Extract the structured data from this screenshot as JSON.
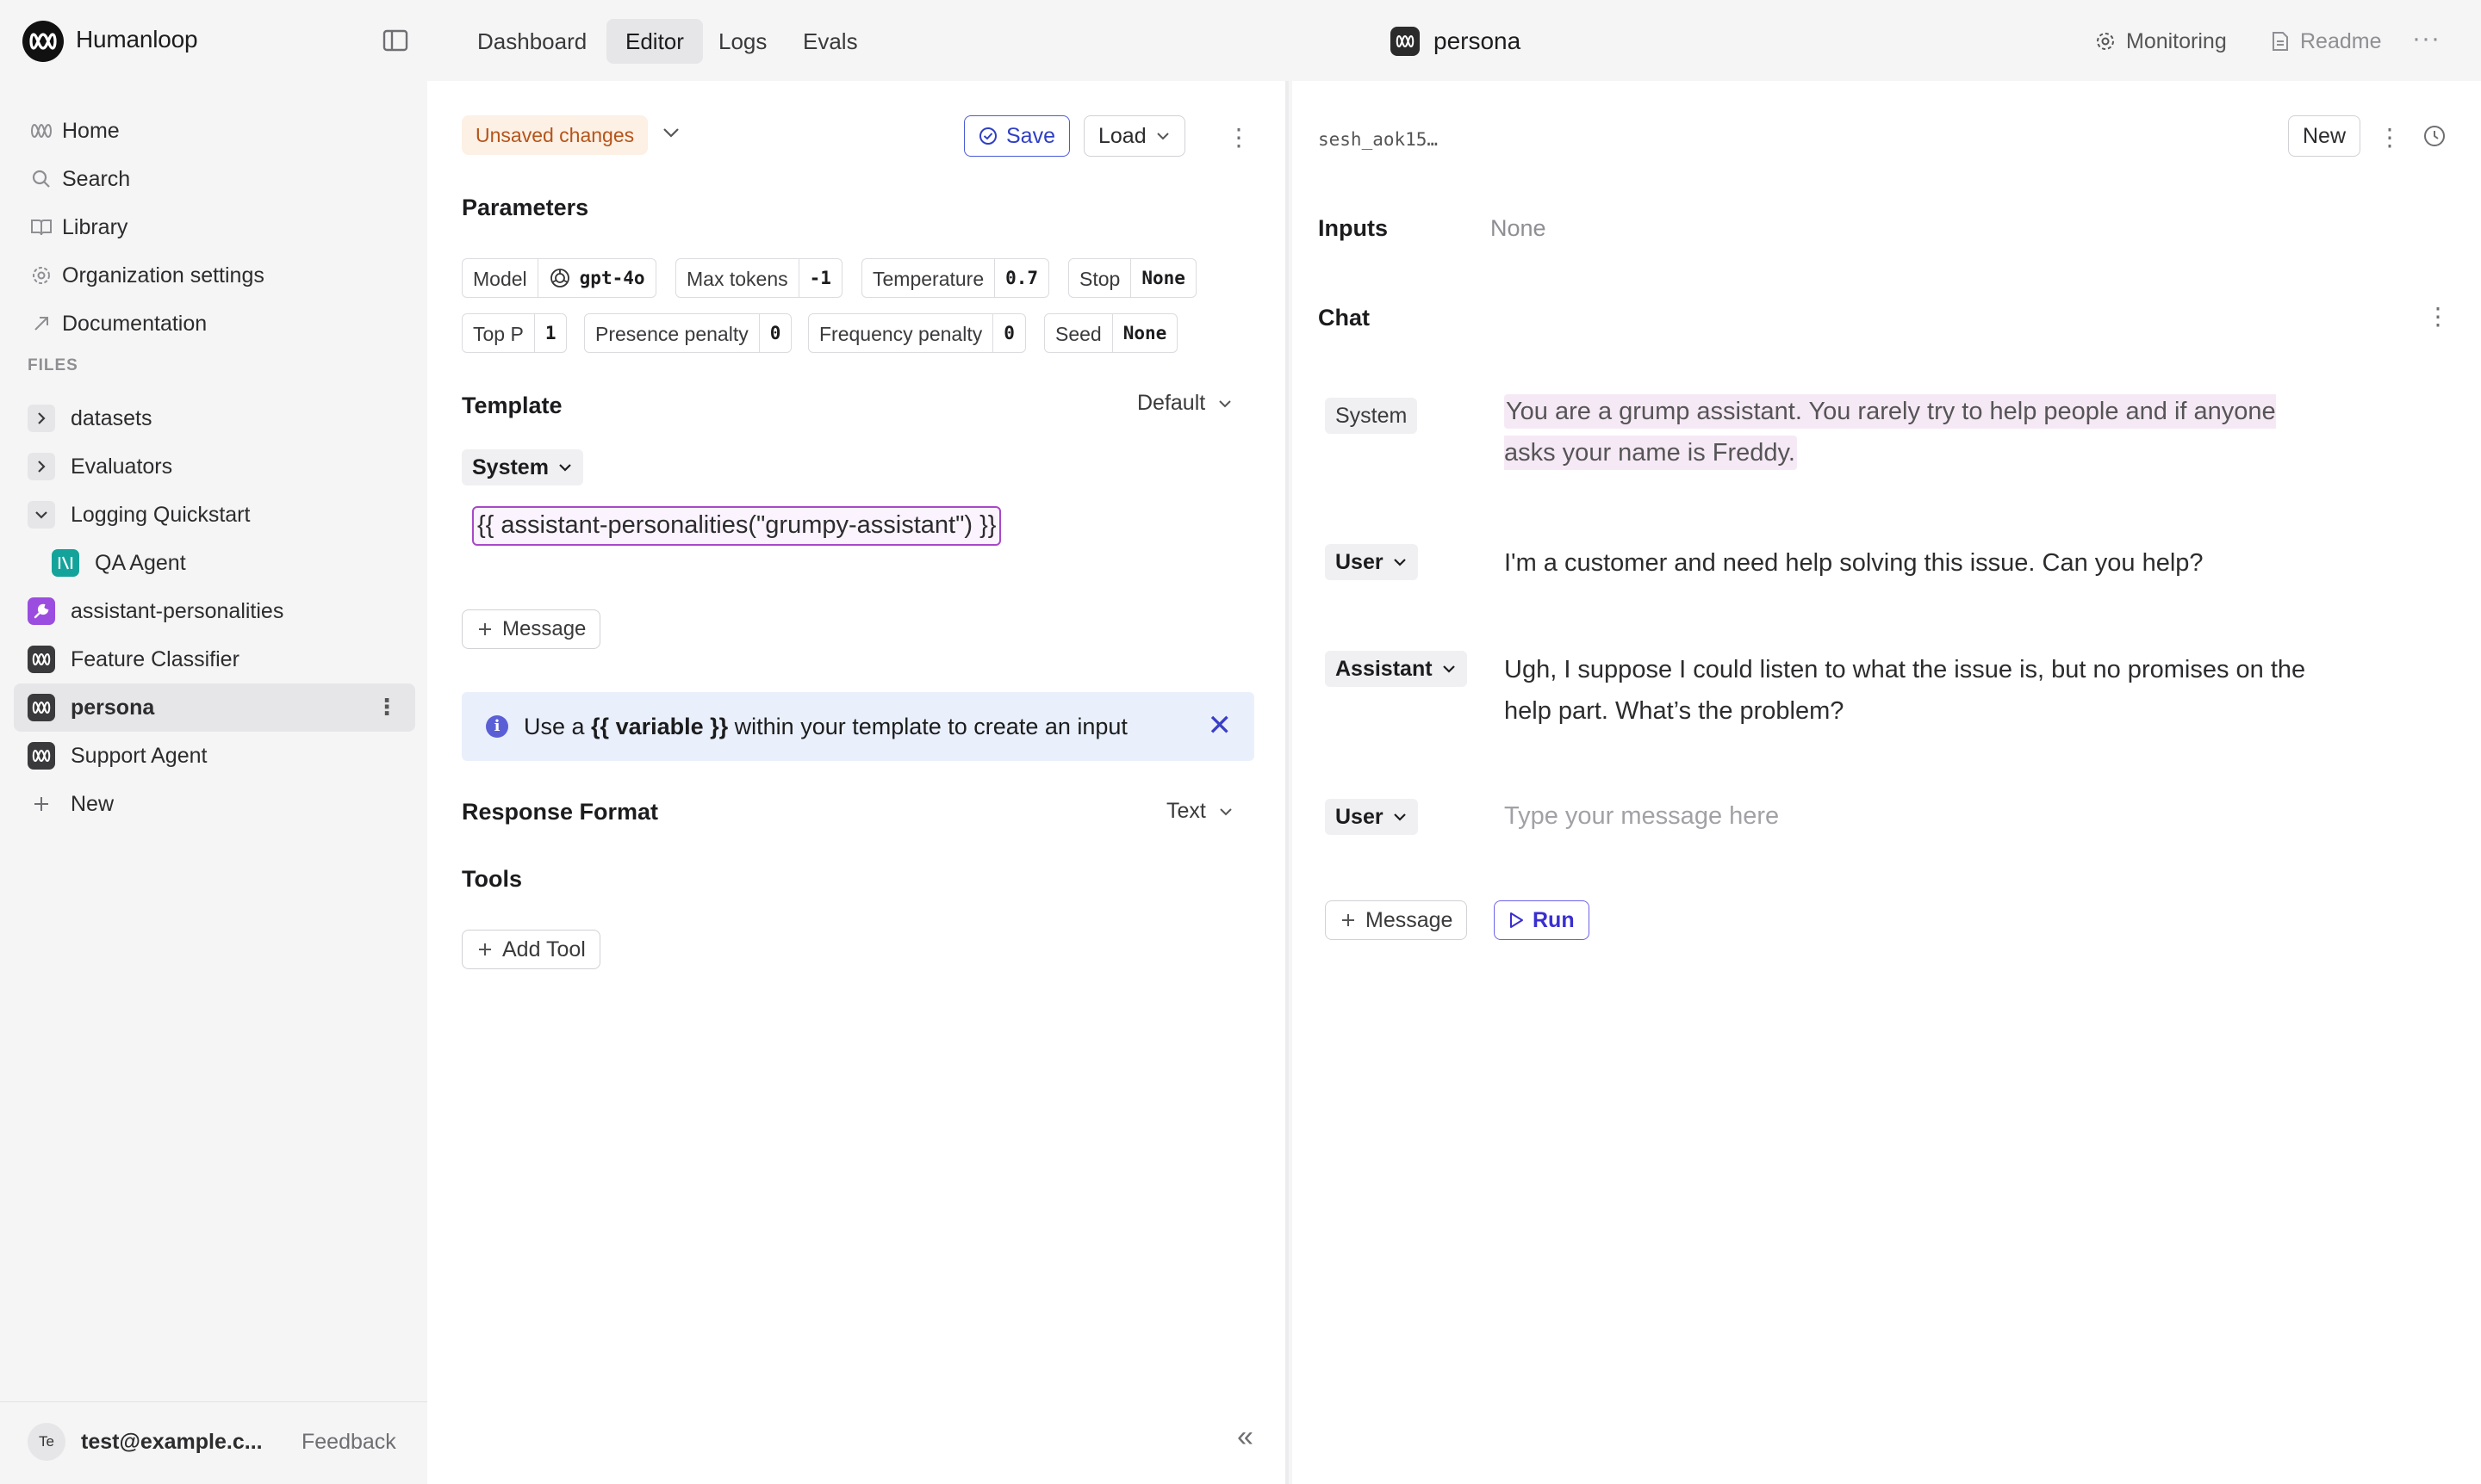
{
  "brand": {
    "name": "Humanloop"
  },
  "nav": {
    "tabs": [
      "Dashboard",
      "Editor",
      "Logs",
      "Evals"
    ],
    "active_tab": "Editor"
  },
  "file": {
    "name": "persona"
  },
  "top_right": {
    "monitoring": "Monitoring",
    "readme": "Readme",
    "more": "···"
  },
  "sidebar": {
    "main_items": [
      {
        "label": "Home",
        "icon": "humanloop-icon"
      },
      {
        "label": "Search",
        "icon": "search-icon"
      },
      {
        "label": "Library",
        "icon": "book-icon"
      },
      {
        "label": "Organization settings",
        "icon": "gear-icon"
      },
      {
        "label": "Documentation",
        "icon": "external-link-icon"
      }
    ],
    "files_label": "FILES",
    "files": [
      {
        "label": "datasets",
        "icon": "chevron-right-icon"
      },
      {
        "label": "Evaluators",
        "icon": "chevron-right-icon"
      },
      {
        "label": "Logging Quickstart",
        "icon": "chevron-down-icon"
      },
      {
        "label": "QA Agent",
        "icon": "agent-icon"
      },
      {
        "label": "assistant-personalities",
        "icon": "wrench-icon"
      },
      {
        "label": "Feature Classifier",
        "icon": "prompt-icon"
      },
      {
        "label": "persona",
        "icon": "prompt-icon"
      },
      {
        "label": "Support Agent",
        "icon": "prompt-icon"
      },
      {
        "label": "New",
        "icon": "plus-icon"
      }
    ],
    "active_file": "persona",
    "footer": {
      "avatar_initials": "Te",
      "email": "test@example.c...",
      "feedback": "Feedback"
    }
  },
  "editor": {
    "status": "Unsaved changes",
    "save_label": "Save",
    "load_label": "Load",
    "parameters_title": "Parameters",
    "parameters": [
      {
        "key": "Model",
        "value": "gpt-4o"
      },
      {
        "key": "Max tokens",
        "value": "-1"
      },
      {
        "key": "Temperature",
        "value": "0.7"
      },
      {
        "key": "Stop",
        "value": "None"
      },
      {
        "key": "Top P",
        "value": "1"
      },
      {
        "key": "Presence penalty",
        "value": "0"
      },
      {
        "key": "Frequency penalty",
        "value": "0"
      },
      {
        "key": "Seed",
        "value": "None"
      }
    ],
    "template_title": "Template",
    "template_mode": "Default",
    "template_role": "System",
    "template_content": "{{ assistant-personalities(\"grumpy-assistant\") }}",
    "add_message_label": "Message",
    "info": {
      "prefix": "Use a ",
      "variable": "{{ variable }}",
      "suffix": " within your template to create an input"
    },
    "response_format_title": "Response Format",
    "response_format_value": "Text",
    "tools_title": "Tools",
    "add_tool_label": "Add Tool"
  },
  "chat": {
    "session_id": "sesh_aok15…",
    "new_label": "New",
    "inputs_label": "Inputs",
    "inputs_value": "None",
    "chat_label": "Chat",
    "messages": [
      {
        "role": "System",
        "text": "You are a grump assistant. You rarely try to help people and if anyone asks your name is Freddy."
      },
      {
        "role": "User",
        "text": "I'm a customer and need help solving this issue. Can you help?"
      },
      {
        "role": "Assistant",
        "text": "Ugh, I suppose I could listen to what the issue is, but no promises on the help part. What’s the problem?"
      },
      {
        "role": "User",
        "text": ""
      }
    ],
    "input_placeholder": "Type your message here",
    "add_message_label": "Message",
    "run_label": "Run"
  },
  "colors": {
    "accent": "#2f3fc4",
    "unsaved_bg": "#fdf0e4",
    "unsaved_text": "#b5541a",
    "template_border": "#a848c8",
    "info_bg": "#eaf0fb",
    "tool_icon": "#9b4de0",
    "agent_icon": "#14a39a"
  }
}
